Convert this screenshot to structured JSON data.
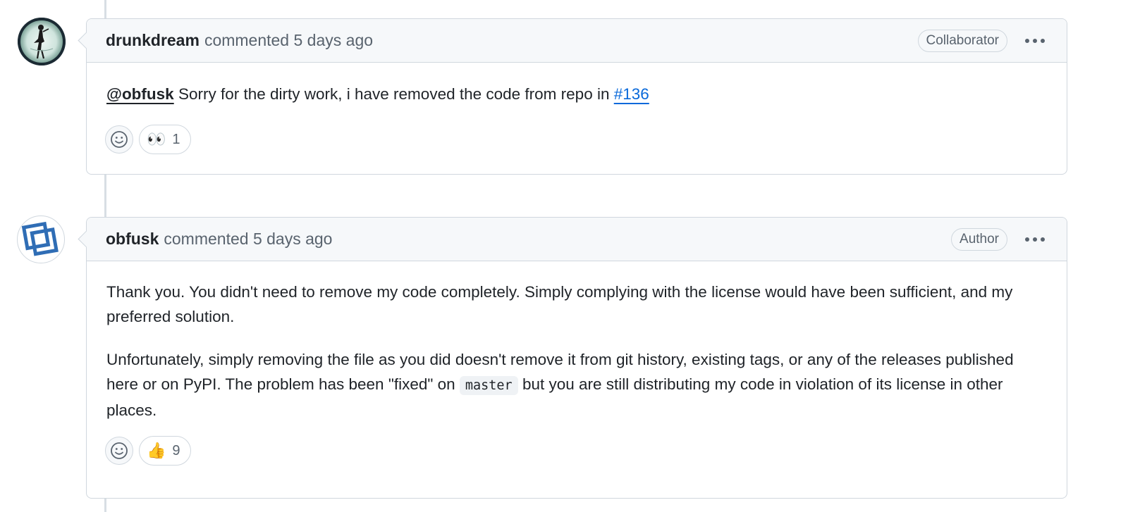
{
  "comments": [
    {
      "author": "drunkdream",
      "meta": "commented 5 days ago",
      "role": "Collaborator",
      "avatar_icon": "sailor-figure-avatar-icon",
      "body": {
        "mention": "@obfusk",
        "text": " Sorry for the dirty work, i have removed the code from repo in ",
        "link": "#136"
      },
      "reaction": {
        "emoji": "👀",
        "count": "1"
      }
    },
    {
      "author": "obfusk",
      "meta": "commented 5 days ago",
      "role": "Author",
      "avatar_icon": "overlapping-squares-avatar-icon",
      "body": {
        "p1": "Thank you. You didn't need to remove my code completely. Simply complying with the license would have been sufficient, and my preferred solution.",
        "p2_before": "Unfortunately, simply removing the file as you did doesn't remove it from git history, existing tags, or any of the releases published here or on PyPI. The problem has been \"fixed\" on ",
        "p2_code": "master",
        "p2_after": " but you are still distributing my code in violation of its license in other places."
      },
      "reaction": {
        "emoji": "👍",
        "count": "9"
      }
    }
  ],
  "colors": {
    "border": "#d0d7de",
    "header_bg": "#f6f8fa",
    "muted_text": "#59636e",
    "link": "#0969da"
  }
}
